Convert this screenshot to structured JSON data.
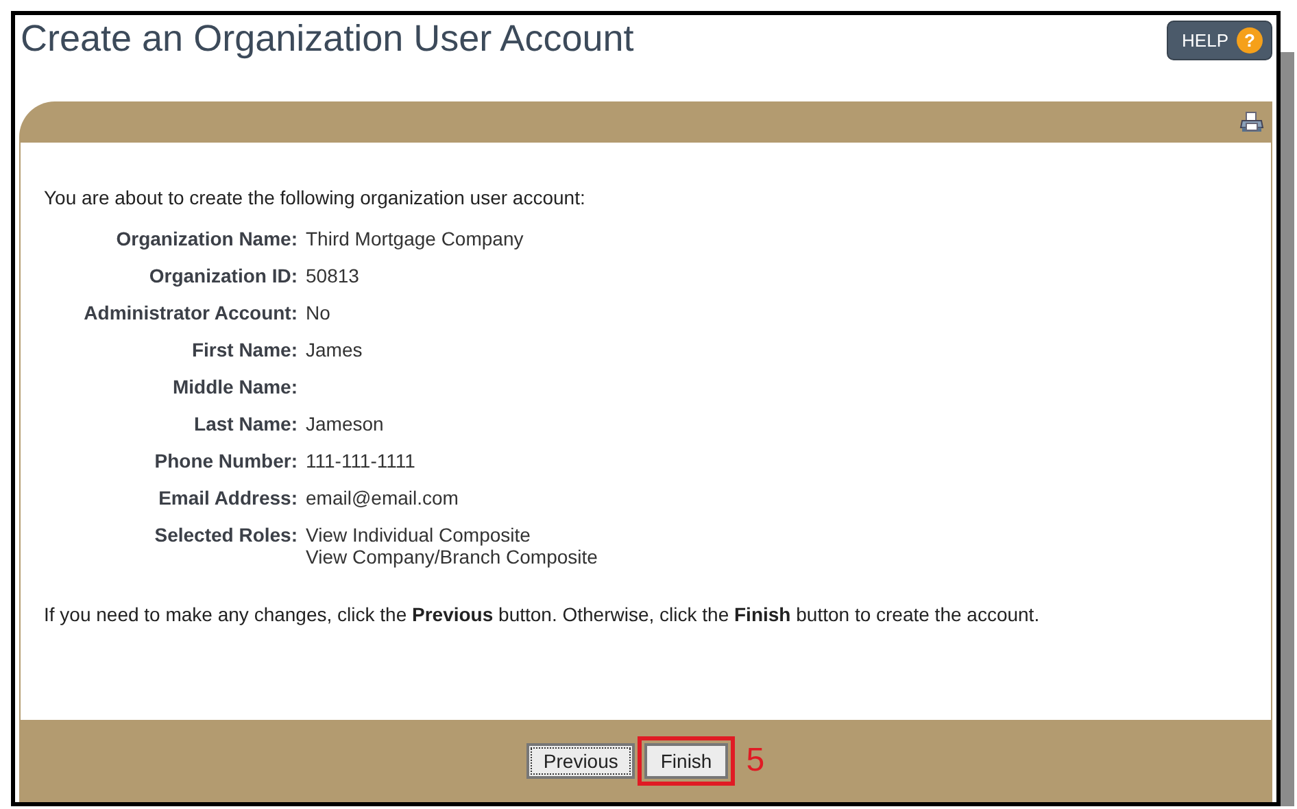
{
  "page": {
    "title": "Create an Organization User Account",
    "help_button": {
      "label": "HELP",
      "icon_text": "?"
    }
  },
  "intro": "You are about to create the following organization user account:",
  "fields": [
    {
      "label": "Organization Name:",
      "values": [
        "Third Mortgage Company"
      ]
    },
    {
      "label": "Organization ID:",
      "values": [
        "50813"
      ]
    },
    {
      "label": "Administrator Account:",
      "values": [
        "No"
      ]
    },
    {
      "label": "First Name:",
      "values": [
        "James"
      ]
    },
    {
      "label": "Middle Name:"
    },
    {
      "label": "Last Name:",
      "values": [
        "Jameson"
      ]
    },
    {
      "label": "Phone Number:",
      "values": [
        "111-111-1111"
      ]
    },
    {
      "label": "Email Address:",
      "values": [
        "email@email.com"
      ]
    },
    {
      "label": "Selected Roles:",
      "values": [
        "View Individual Composite",
        "View Company/Branch Composite"
      ]
    }
  ],
  "note": "If you need to make any changes, click the **Previous** button. Otherwise, click the **Finish** button to create the account.",
  "buttons": [
    {
      "label": "Previous",
      "focused": true,
      "highlighted": false
    },
    {
      "label": "Finish",
      "focused": false,
      "highlighted": true
    }
  ],
  "callout": "5"
}
